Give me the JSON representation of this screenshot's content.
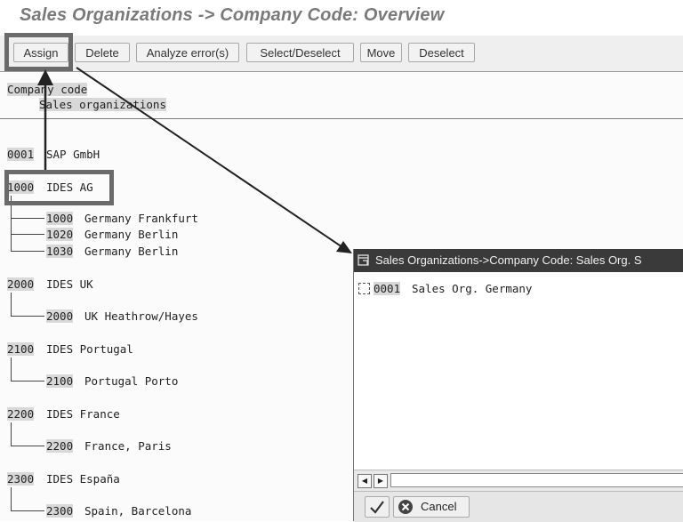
{
  "window": {
    "title": "Sales Organizations -> Company Code: Overview"
  },
  "toolbar": {
    "buttons": [
      {
        "label": "Assign"
      },
      {
        "label": "Delete"
      },
      {
        "label": "Analyze error(s)"
      },
      {
        "label": "Select/Deselect"
      },
      {
        "label": "Move"
      },
      {
        "label": "Deselect"
      }
    ]
  },
  "header": {
    "level1": "Company code",
    "level2": "Sales organizations"
  },
  "tree": {
    "company_codes": [
      {
        "code": "0001",
        "name": "SAP GmbH",
        "sales_orgs": []
      },
      {
        "code": "1000",
        "name": "IDES AG",
        "sales_orgs": [
          {
            "code": "1000",
            "name": "Germany Frankfurt"
          },
          {
            "code": "1020",
            "name": "Germany Berlin"
          },
          {
            "code": "1030",
            "name": "Germany Berlin"
          }
        ]
      },
      {
        "code": "2000",
        "name": "IDES UK",
        "sales_orgs": [
          {
            "code": "2000",
            "name": "UK Heathrow/Hayes"
          }
        ]
      },
      {
        "code": "2100",
        "name": "IDES Portugal",
        "sales_orgs": [
          {
            "code": "2100",
            "name": "Portugal Porto"
          }
        ]
      },
      {
        "code": "2200",
        "name": "IDES France",
        "sales_orgs": [
          {
            "code": "2200",
            "name": "France, Paris"
          }
        ]
      },
      {
        "code": "2300",
        "name": "IDES España",
        "sales_orgs": [
          {
            "code": "2300",
            "name": "Spain, Barcelona"
          }
        ]
      }
    ]
  },
  "dialog": {
    "title": "Sales Organizations->Company Code: Sales Org. S",
    "items": [
      {
        "code": "0001",
        "name": "Sales Org. Germany",
        "checked": false
      }
    ],
    "confirm_icon": "checkmark-icon",
    "cancel_label": "Cancel"
  },
  "colors": {
    "callout": "#6a6a6a",
    "dialog_title_bg": "#3a3a3a",
    "highlight": "#d8d8d8"
  }
}
